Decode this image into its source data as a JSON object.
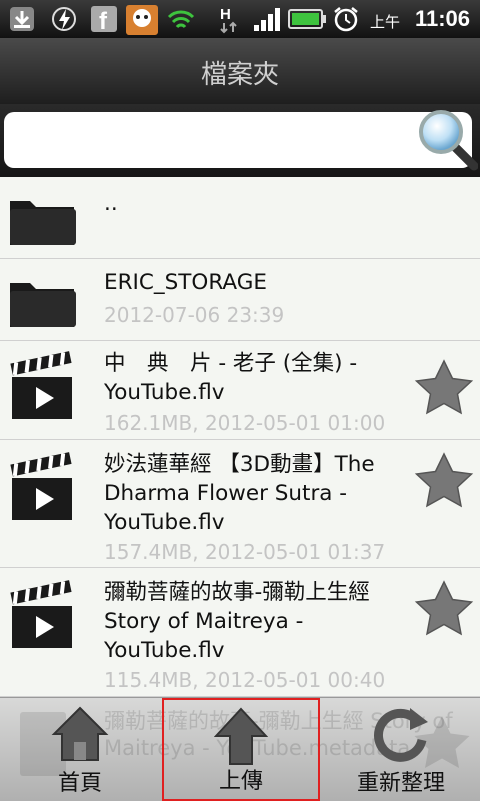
{
  "status_bar": {
    "ampm": "上午",
    "time": "11:06",
    "icons": [
      "download-icon",
      "lightning-icon",
      "facebook-icon",
      "bonjour-icon",
      "wifi-icon",
      "hplus-icon",
      "signal-icon",
      "battery-icon",
      "alarm-icon"
    ]
  },
  "header": {
    "title": "檔案夾"
  },
  "search": {
    "value": "",
    "placeholder": ""
  },
  "files": [
    {
      "name": "..",
      "meta": "",
      "type": "folder",
      "starred": false
    },
    {
      "name": "ERIC_STORAGE",
      "meta": "2012-07-06 23:39",
      "type": "folder",
      "starred": false
    },
    {
      "name": "中　典　片 - 老子 (全集) - YouTube.flv",
      "meta": "162.1MB, 2012-05-01 01:00",
      "type": "video",
      "starred": true
    },
    {
      "name": "妙法蓮華經 【3D動畫】The Dharma Flower Sutra - YouTube.flv",
      "meta": "157.4MB, 2012-05-01 01:37",
      "type": "video",
      "starred": true
    },
    {
      "name": "彌勒菩薩的故事-彌勒上生經 Story of Maitreya - YouTube.flv",
      "meta": "115.4MB, 2012-05-01 00:40",
      "type": "video",
      "starred": true
    },
    {
      "name": "彌勒菩薩的故事-彌勒上生經 Story of Maitreya - YouTube.metadata",
      "meta": "",
      "type": "file",
      "starred": true
    }
  ],
  "bottom_nav": {
    "home_label": "首頁",
    "upload_label": "上傳",
    "refresh_label": "重新整理"
  }
}
